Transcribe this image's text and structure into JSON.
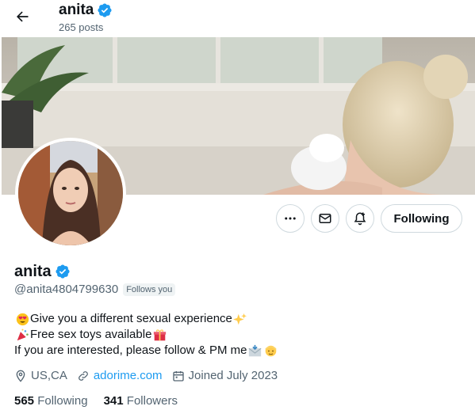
{
  "header": {
    "name": "anita",
    "posts": "265 posts"
  },
  "profile": {
    "name": "anita",
    "handle": "@anita4804799630",
    "follows_you": "Follows you",
    "verified_color": "#1d9bf0"
  },
  "actions": {
    "more_icon": "more-icon",
    "message_icon": "message-icon",
    "notify_icon": "bell-plus-icon",
    "following_label": "Following"
  },
  "bio": {
    "line1": "Give you a different sexual experience",
    "line2": "Free sex toys available",
    "line3": "If you are interested, please follow & PM me"
  },
  "meta": {
    "location": "US,CA",
    "website": "adorime.com",
    "joined": "Joined July 2023"
  },
  "stats": {
    "following_count": "565",
    "following_label": "Following",
    "followers_count": "341",
    "followers_label": "Followers"
  }
}
